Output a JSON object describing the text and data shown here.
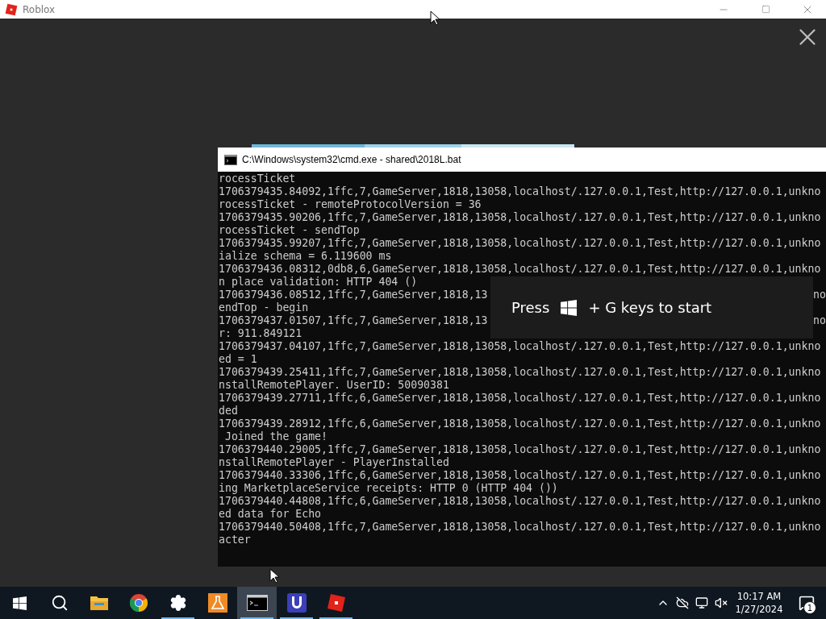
{
  "roblox_window": {
    "title": "Roblox"
  },
  "console": {
    "title": "C:\\Windows\\system32\\cmd.exe - shared\\2018L.bat",
    "lines": [
      {
        "text": "rocessTicket"
      },
      {
        "text": "1706379435.84092,1ffc,7,GameServer,1818,13058,localhost/.127.0.0.1,Test,http://127.0.0.1,unkno"
      },
      {
        "text": "rocessTicket - remoteProtocolVersion = 36"
      },
      {
        "text": "1706379435.90206,1ffc,7,GameServer,1818,13058,localhost/.127.0.0.1,Test,http://127.0.0.1,unkno"
      },
      {
        "text": "rocessTicket - sendTop"
      },
      {
        "text": "1706379435.99207,1ffc,7,GameServer,1818,13058,localhost/.127.0.0.1,Test,http://127.0.0.1,unkno"
      },
      {
        "text": "ialize schema = 6.119600 ms"
      },
      {
        "text": "1706379436.08312,0db8,6,GameServer,1818,13058,localhost/.127.0.0.1,Test,http://127.0.0.1,unkno"
      },
      {
        "text": "n place validation: HTTP 404 ()"
      },
      {
        "text": "1706379436.08512,1ffc,7,GameServer,1818,13",
        "tail": "no"
      },
      {
        "text": "endTop - begin"
      },
      {
        "text": "1706379437.01507,1ffc,7,GameServer,1818,13",
        "tail": "no"
      },
      {
        "text": "r: 911.849121"
      },
      {
        "text": "1706379437.04107,1ffc,7,GameServer,1818,13058,localhost/.127.0.0.1,Test,http://127.0.0.1,unkno"
      },
      {
        "text": "ed = 1"
      },
      {
        "text": "1706379439.25411,1ffc,7,GameServer,1818,13058,localhost/.127.0.0.1,Test,http://127.0.0.1,unkno"
      },
      {
        "text": "nstallRemotePlayer. UserID: 50090381"
      },
      {
        "text": "1706379439.27711,1ffc,6,GameServer,1818,13058,localhost/.127.0.0.1,Test,http://127.0.0.1,unkno"
      },
      {
        "text": "ded"
      },
      {
        "text": "1706379439.28912,1ffc,6,GameServer,1818,13058,localhost/.127.0.0.1,Test,http://127.0.0.1,unkno"
      },
      {
        "text": " Joined the game!"
      },
      {
        "text": "1706379440.29005,1ffc,7,GameServer,1818,13058,localhost/.127.0.0.1,Test,http://127.0.0.1,unkno"
      },
      {
        "text": "nstallRemotePlayer - PlayerInstalled"
      },
      {
        "text": "1706379440.33306,1ffc,6,GameServer,1818,13058,localhost/.127.0.0.1,Test,http://127.0.0.1,unkno"
      },
      {
        "text": "ing MarketplaceService receipts: HTTP 0 (HTTP 404 ())"
      },
      {
        "text": "1706379440.44808,1ffc,6,GameServer,1818,13058,localhost/.127.0.0.1,Test,http://127.0.0.1,unkno"
      },
      {
        "text": "ed data for Echo"
      },
      {
        "text": "1706379440.50408,1ffc,7,GameServer,1818,13058,localhost/.127.0.0.1,Test,http://127.0.0.1,unkno"
      },
      {
        "text": "acter"
      }
    ]
  },
  "toast": {
    "before": "Press",
    "after": "+ G keys to start"
  },
  "taskbar": {
    "apps": [
      {
        "kind": "start",
        "running": false,
        "selected": false
      },
      {
        "kind": "search",
        "running": false,
        "selected": false
      },
      {
        "kind": "explorer",
        "running": false,
        "selected": false
      },
      {
        "kind": "chrome",
        "running": false,
        "selected": false
      },
      {
        "kind": "settings",
        "running": true,
        "selected": false
      },
      {
        "kind": "flask",
        "running": false,
        "selected": false
      },
      {
        "kind": "terminal",
        "running": true,
        "selected": true
      },
      {
        "kind": "u-app",
        "running": true,
        "selected": false
      },
      {
        "kind": "roblox",
        "running": true,
        "selected": false
      }
    ],
    "time": "10:17 AM",
    "date": "1/27/2024",
    "notifications": "1"
  }
}
